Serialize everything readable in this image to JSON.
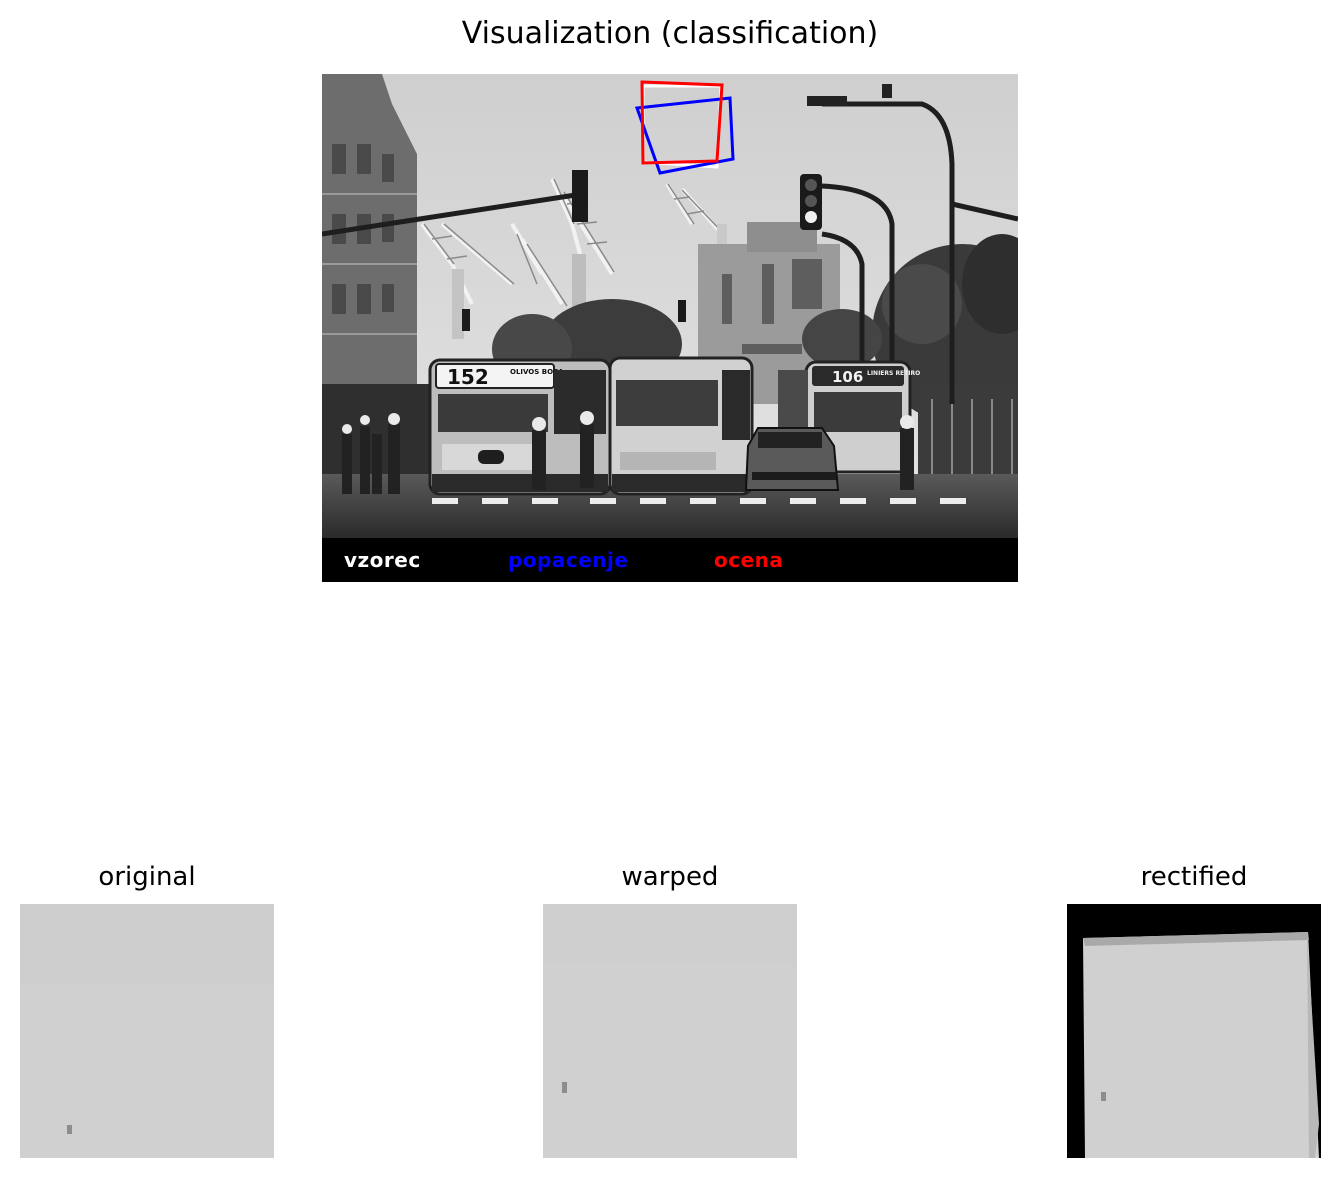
{
  "figure": {
    "title": "Visualization (classification)"
  },
  "main_image": {
    "scene": "grayscale street photo: buses, traffic lights, cranes",
    "bus_left_number": "152",
    "bus_left_route": "OLIVOS BOCA",
    "bus_right_number": "106",
    "bus_right_route": "LINIERS RETIRO",
    "legend": {
      "vzorec": "vzorec",
      "popacenje": "popacenje",
      "ocena": "ocena"
    },
    "colors": {
      "vzorec": "#ffffff",
      "popacenje": "#0000ff",
      "ocena": "#ff0000"
    }
  },
  "panels": [
    {
      "title": "original"
    },
    {
      "title": "warped"
    },
    {
      "title": "rectified"
    }
  ]
}
